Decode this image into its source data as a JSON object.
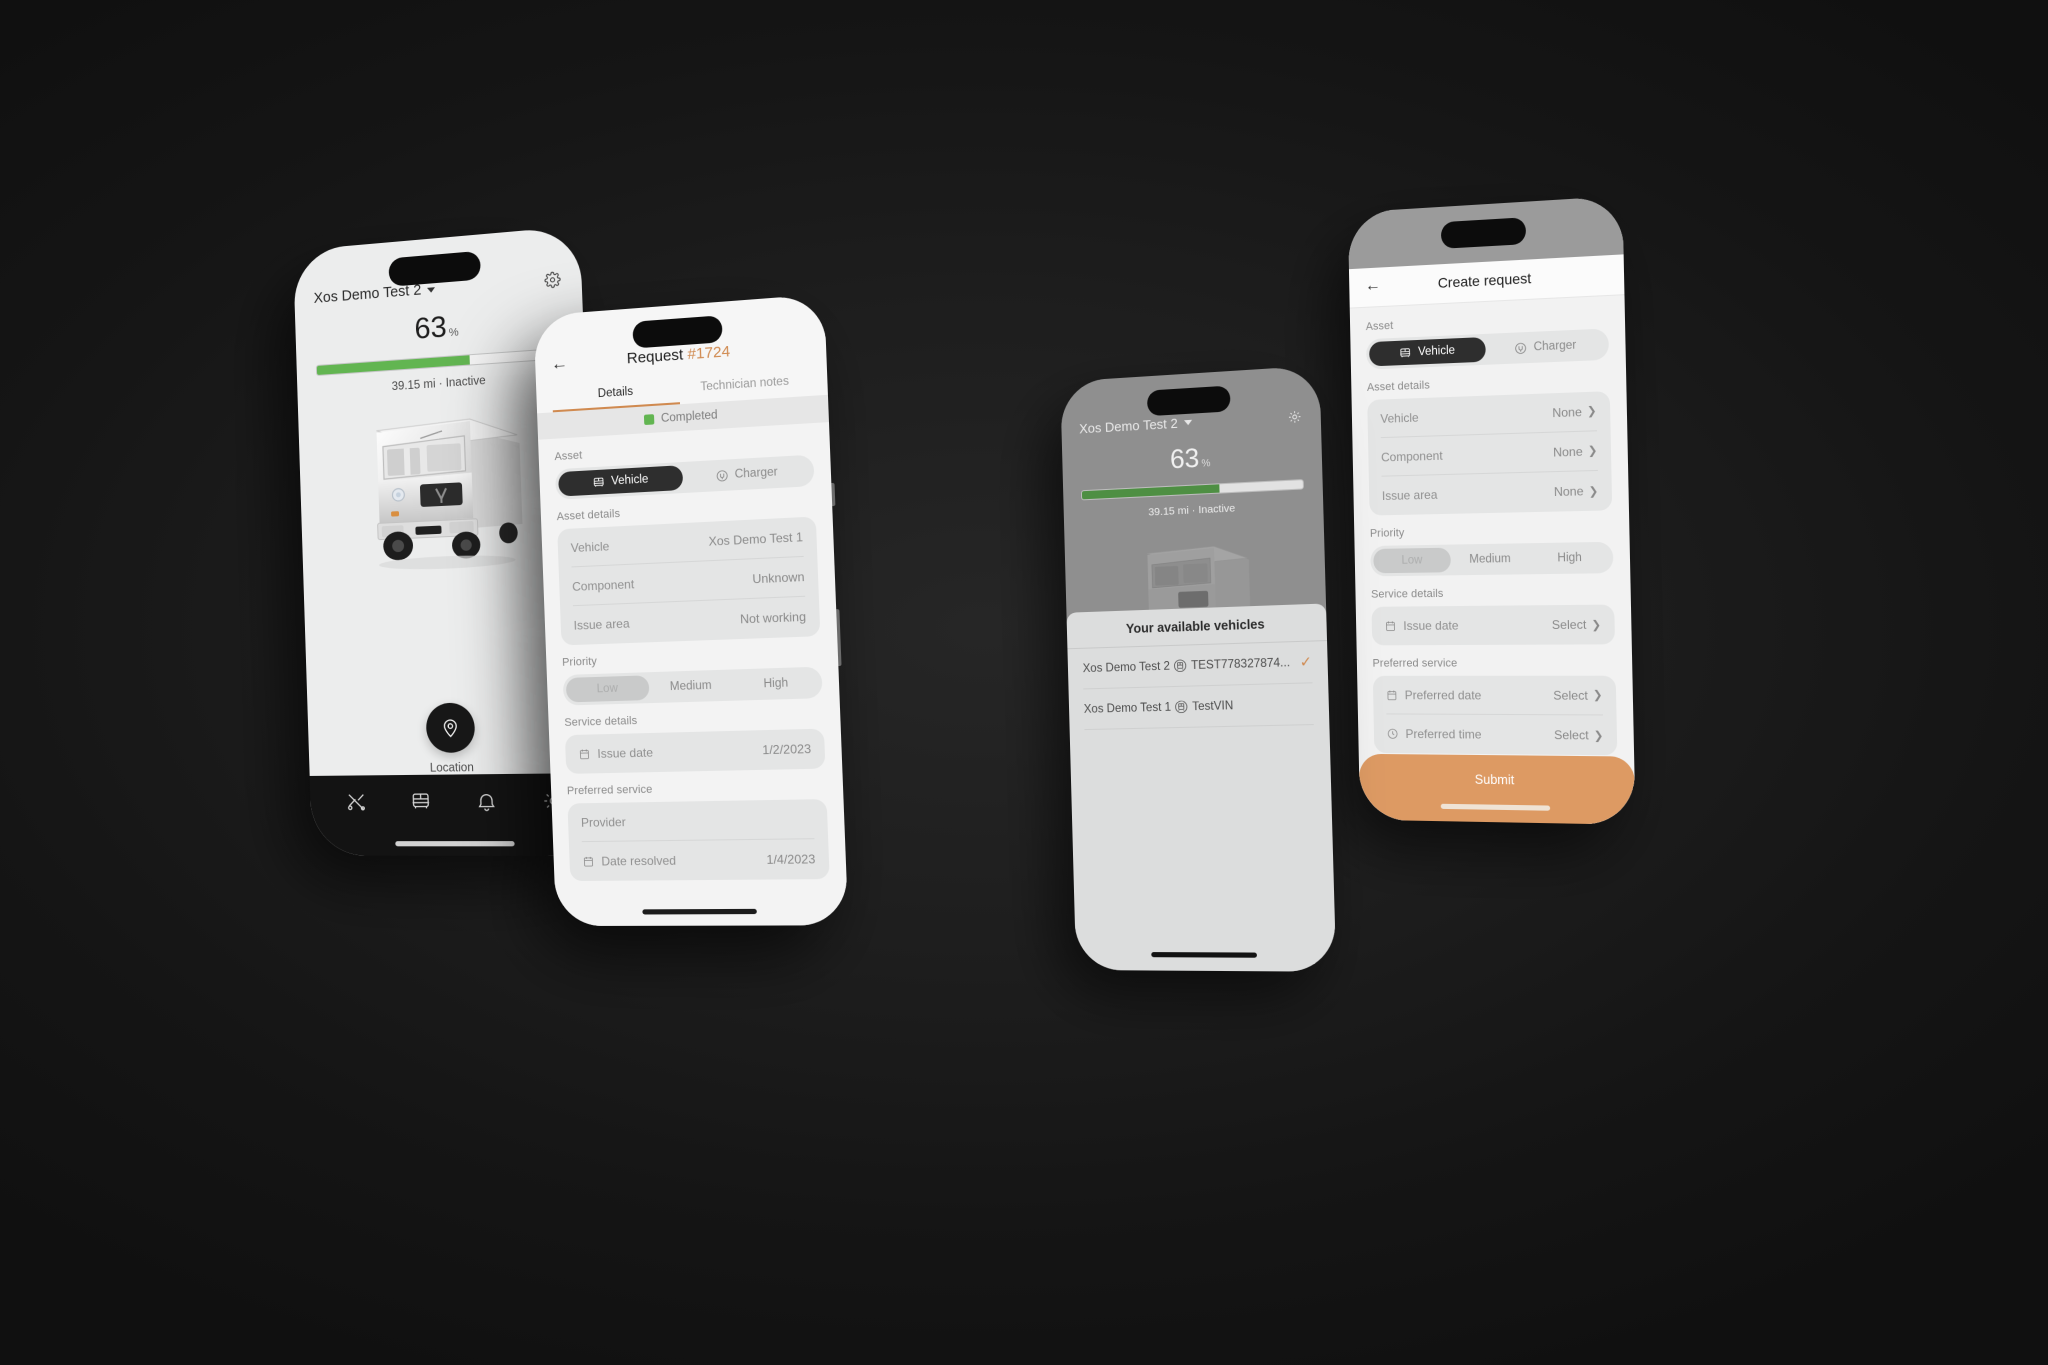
{
  "background_color": "#171717",
  "accent_color": "#d08a50",
  "green_color": "#62b551",
  "phone1": {
    "name": "vehicle-dashboard",
    "header": {
      "vehicle_name": "Xos Demo Test 2",
      "settings_icon": "gear-icon"
    },
    "battery": {
      "value": "63",
      "unit": "%",
      "percent": 63
    },
    "subtitle": "39.15 mi · Inactive",
    "vehicle_image_alt": "xos-delivery-truck",
    "location_button": {
      "label": "Location",
      "icon": "map-pin-icon"
    },
    "bottom_nav": [
      {
        "name": "service",
        "icon": "tools-icon"
      },
      {
        "name": "vehicles",
        "icon": "vehicle-icon"
      },
      {
        "name": "notifications",
        "icon": "bell-icon"
      },
      {
        "name": "settings",
        "icon": "gear-icon"
      }
    ]
  },
  "phone2": {
    "name": "request-detail",
    "back_icon": "arrow-left-icon",
    "title": "Request",
    "request_id": "#1724",
    "tabs": [
      {
        "label": "Details",
        "active": true
      },
      {
        "label": "Technician notes",
        "active": false
      }
    ],
    "status": "Completed",
    "asset_label": "Asset",
    "asset_options": [
      {
        "label": "Vehicle",
        "icon": "vehicle-icon",
        "selected": true
      },
      {
        "label": "Charger",
        "icon": "charger-icon",
        "selected": false
      }
    ],
    "asset_details_label": "Asset details",
    "asset_details": [
      {
        "key": "Vehicle",
        "value": "Xos Demo Test 1"
      },
      {
        "key": "Component",
        "value": "Unknown"
      },
      {
        "key": "Issue area",
        "value": "Not working"
      }
    ],
    "priority_label": "Priority",
    "priority_options": [
      {
        "label": "Low",
        "selected": true
      },
      {
        "label": "Medium",
        "selected": false
      },
      {
        "label": "High",
        "selected": false
      }
    ],
    "service_label": "Service details",
    "service_rows": [
      {
        "key": "Issue date",
        "value": "1/2/2023",
        "icon": "calendar-icon"
      }
    ],
    "preferred_label": "Preferred service",
    "preferred_rows": [
      {
        "key": "Provider",
        "value": "",
        "icon": ""
      },
      {
        "key": "Date resolved",
        "value": "1/4/2023",
        "icon": "calendar-icon"
      }
    ]
  },
  "phone3": {
    "name": "vehicle-picker",
    "header": {
      "vehicle_name": "Xos Demo Test 2",
      "settings_icon": "gear-icon"
    },
    "battery": {
      "value": "63",
      "unit": "%",
      "percent": 63
    },
    "subtitle": "39.15 mi · Inactive",
    "sheet_title": "Your available vehicles",
    "vehicles": [
      {
        "name": "Xos Demo Test 2",
        "vin": "TEST778327874...",
        "icon": "vehicle-icon",
        "selected": true
      },
      {
        "name": "Xos Demo Test 1",
        "vin": "TestVIN",
        "icon": "vehicle-icon",
        "selected": false
      }
    ],
    "check_icon": "check-icon"
  },
  "phone4": {
    "name": "create-request",
    "back_icon": "arrow-left-icon",
    "title": "Create request",
    "asset_label": "Asset",
    "asset_options": [
      {
        "label": "Vehicle",
        "icon": "vehicle-icon",
        "selected": true
      },
      {
        "label": "Charger",
        "icon": "charger-icon",
        "selected": false
      }
    ],
    "asset_details_label": "Asset details",
    "asset_details": [
      {
        "key": "Vehicle",
        "value": "None"
      },
      {
        "key": "Component",
        "value": "None"
      },
      {
        "key": "Issue area",
        "value": "None"
      }
    ],
    "priority_label": "Priority",
    "priority_options": [
      {
        "label": "Low",
        "selected": true
      },
      {
        "label": "Medium",
        "selected": false
      },
      {
        "label": "High",
        "selected": false
      }
    ],
    "service_label": "Service details",
    "service_rows": [
      {
        "key": "Issue date",
        "value": "Select",
        "icon": "calendar-icon"
      }
    ],
    "preferred_label": "Preferred service",
    "preferred_rows": [
      {
        "key": "Preferred date",
        "value": "Select",
        "icon": "calendar-icon"
      },
      {
        "key": "Preferred time",
        "value": "Select",
        "icon": "clock-icon"
      }
    ],
    "submit_label": "Submit"
  }
}
